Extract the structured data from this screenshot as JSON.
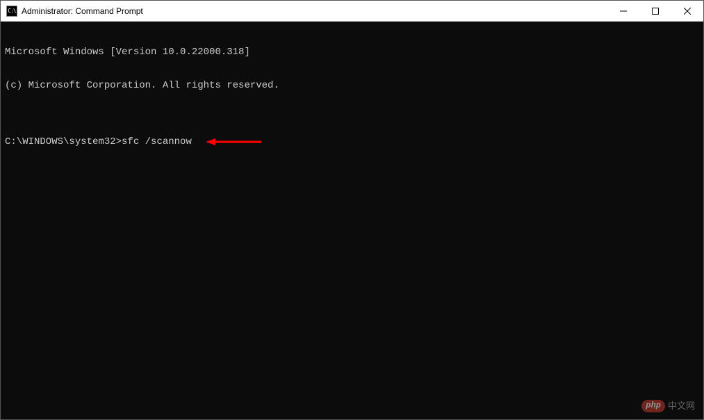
{
  "window": {
    "title": "Administrator: Command Prompt",
    "icon_label": "cmd-icon"
  },
  "terminal": {
    "line1": "Microsoft Windows [Version 10.0.22000.318]",
    "line2": "(c) Microsoft Corporation. All rights reserved.",
    "blank": "",
    "prompt": "C:\\WINDOWS\\system32>",
    "command": "sfc /scannow"
  },
  "annotation": {
    "arrow_color": "#ff0000"
  },
  "watermark": {
    "badge": "php",
    "text": "中文网"
  }
}
